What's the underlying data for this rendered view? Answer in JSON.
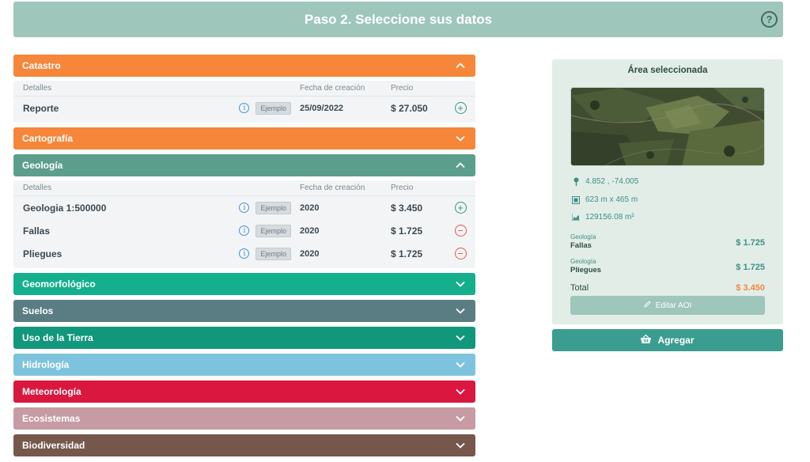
{
  "header": {
    "title": "Paso 2. Seleccione sus datos",
    "help_icon": "?"
  },
  "columns": {
    "details": "Detalles",
    "date": "Fecha de creación",
    "price": "Precio"
  },
  "categories": [
    {
      "label": "Catastro",
      "color": "#f5863a",
      "expanded": true,
      "rows": [
        {
          "name": "Reporte",
          "example": "Ejemplo",
          "date": "25/09/2022",
          "price": "$ 27.050",
          "action": "add"
        }
      ]
    },
    {
      "label": "Cartografía",
      "color": "#f5863a",
      "expanded": false
    },
    {
      "label": "Geología",
      "color": "#5c9e8c",
      "expanded": true,
      "rows": [
        {
          "name": "Geologia 1:500000",
          "example": "Ejemplo",
          "date": "2020",
          "price": "$ 3.450",
          "action": "add"
        },
        {
          "name": "Fallas",
          "example": "Ejemplo",
          "date": "2020",
          "price": "$ 1.725",
          "action": "remove"
        },
        {
          "name": "Pliegues",
          "example": "Ejemplo",
          "date": "2020",
          "price": "$ 1.725",
          "action": "remove"
        }
      ]
    },
    {
      "label": "Geomorfológico",
      "color": "#14b08e",
      "expanded": false
    },
    {
      "label": "Suelos",
      "color": "#597d83",
      "expanded": false
    },
    {
      "label": "Uso de la Tierra",
      "color": "#11977b",
      "expanded": false
    },
    {
      "label": "Hidrología",
      "color": "#7ec3dd",
      "expanded": false
    },
    {
      "label": "Meteorología",
      "color": "#da173f",
      "expanded": false
    },
    {
      "label": "Ecosistemas",
      "color": "#c69ba3",
      "expanded": false
    },
    {
      "label": "Biodiversidad",
      "color": "#76574c",
      "expanded": false
    }
  ],
  "aoi": {
    "title": "Área seleccionada",
    "coords": "4.852 , -74.005",
    "dimensions": "623 m x 465 m",
    "area": "129156.08 m²",
    "items": [
      {
        "category": "Geología",
        "name": "Fallas",
        "price": "$ 1.725"
      },
      {
        "category": "Geología",
        "name": "Pliegues",
        "price": "$ 1.725"
      }
    ],
    "total_label": "Total",
    "total_value": "$ 3.450",
    "edit_label": "Editar AOI"
  },
  "add_button": {
    "label": "Agregar"
  }
}
